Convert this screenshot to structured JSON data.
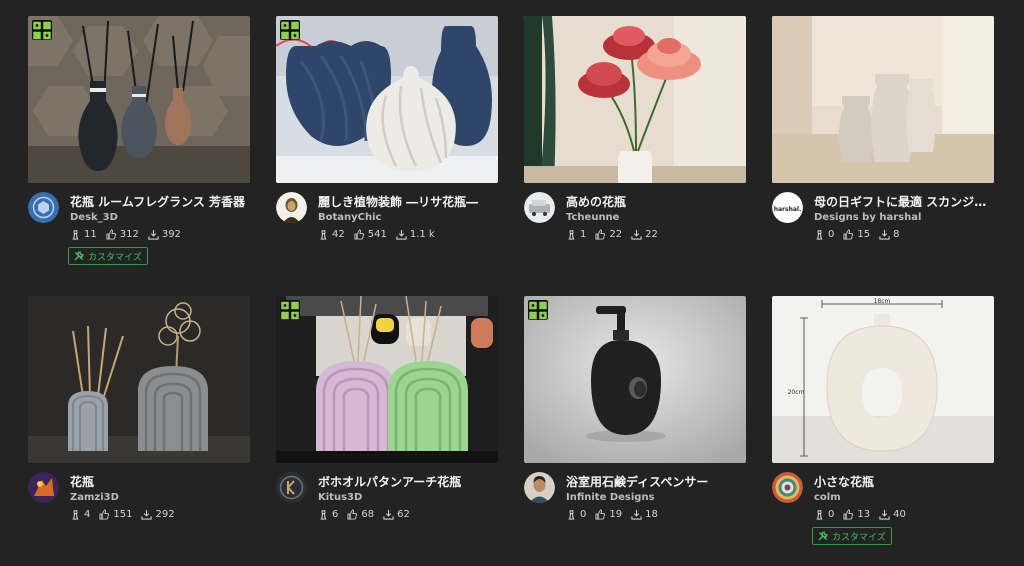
{
  "cards": [
    {
      "title": "花瓶 ルームフレグランス 芳香器",
      "author": "Desk_3D",
      "prints": "11",
      "likes": "312",
      "downloads": "392",
      "customize": "カスタマイズ"
    },
    {
      "title": "麗しき植物装飾 ―リサ花瓶―",
      "author": "BotanyChic",
      "prints": "42",
      "likes": "541",
      "downloads": "1.1 k"
    },
    {
      "title": "高めの花瓶",
      "author": "Tcheunne",
      "prints": "1",
      "likes": "22",
      "downloads": "22"
    },
    {
      "title": "母の日ギフトに最適 スカンジナビ…",
      "author": "Designs by harshal",
      "prints": "0",
      "likes": "15",
      "downloads": "8"
    },
    {
      "title": "花瓶",
      "author": "Zamzi3D",
      "prints": "4",
      "likes": "151",
      "downloads": "292"
    },
    {
      "title": "ボホオルパタンアーチ花瓶",
      "author": "Kitus3D",
      "prints": "6",
      "likes": "68",
      "downloads": "62"
    },
    {
      "title": "浴室用石鹸ディスペンサー",
      "author": "Infinite Designs",
      "prints": "0",
      "likes": "19",
      "downloads": "18"
    },
    {
      "title": "小さな花瓶",
      "author": "colm",
      "prints": "0",
      "likes": "13",
      "downloads": "40",
      "customize": "カスタマイズ"
    }
  ],
  "thumb_labels": {
    "card4_avatar": "harshal.",
    "card8_width": "18cm",
    "card8_height": "20cm"
  },
  "colors": {
    "accent_green": "#3fc45e",
    "badge_green": "#8fd14f",
    "background": "#232323"
  },
  "icons": {
    "print": "print-icon",
    "like": "thumbs-up-icon",
    "download": "download-icon",
    "badge": "maker-badge-icon",
    "customize": "wrench-icon"
  }
}
